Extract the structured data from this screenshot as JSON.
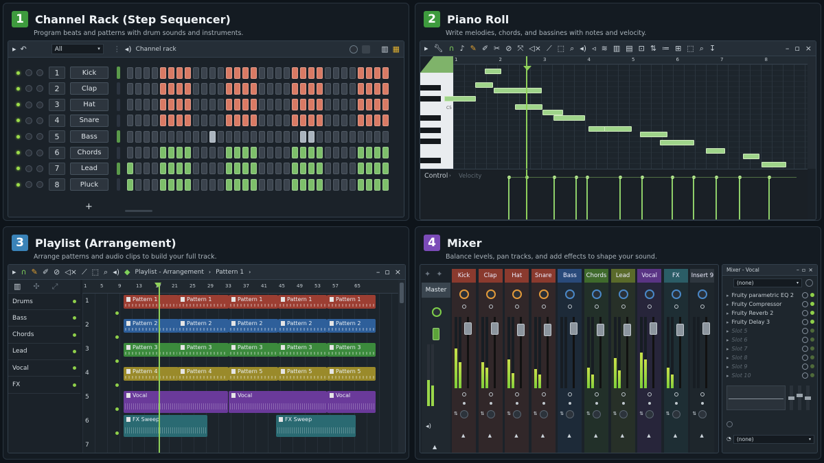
{
  "panel1": {
    "num": "1",
    "title": "Channel Rack (Step Sequencer)",
    "subtitle": "Program beats and patterns with drum sounds and instruments.",
    "color": "#3e9b3e",
    "toolbar": {
      "filter": "All",
      "window_title": "Channel rack"
    },
    "add_label": "+",
    "channels": [
      {
        "num": "1",
        "name": "Kick",
        "steps": [
          0,
          0,
          0,
          0,
          1,
          1,
          1,
          1,
          0,
          0,
          0,
          0,
          1,
          1,
          1,
          1,
          0,
          0,
          0,
          0,
          1,
          1,
          1,
          1,
          0,
          0,
          0,
          0,
          1,
          1,
          1,
          1
        ],
        "color": "#d97a64"
      },
      {
        "num": "2",
        "name": "Clap",
        "steps": [
          0,
          0,
          0,
          0,
          1,
          1,
          1,
          1,
          0,
          0,
          0,
          0,
          1,
          1,
          1,
          1,
          0,
          0,
          0,
          0,
          1,
          1,
          1,
          1,
          0,
          0,
          0,
          0,
          1,
          1,
          1,
          1
        ],
        "color": "#d97a64"
      },
      {
        "num": "3",
        "name": "Hat",
        "steps": [
          0,
          0,
          0,
          0,
          1,
          1,
          1,
          1,
          0,
          0,
          0,
          0,
          1,
          1,
          1,
          1,
          0,
          0,
          0,
          0,
          1,
          1,
          1,
          1,
          0,
          0,
          0,
          0,
          1,
          1,
          1,
          1
        ],
        "color": "#d97a64"
      },
      {
        "num": "4",
        "name": "Snare",
        "steps": [
          0,
          0,
          0,
          0,
          1,
          1,
          1,
          1,
          0,
          0,
          0,
          0,
          1,
          1,
          1,
          1,
          0,
          0,
          0,
          0,
          1,
          1,
          1,
          1,
          0,
          0,
          0,
          0,
          1,
          1,
          1,
          1
        ],
        "color": "#d97a64"
      },
      {
        "num": "5",
        "name": "Bass",
        "steps": [
          0,
          0,
          0,
          0,
          0,
          0,
          0,
          0,
          0,
          0,
          1,
          0,
          0,
          0,
          0,
          0,
          0,
          0,
          0,
          0,
          0,
          1,
          1,
          0,
          0,
          0,
          0,
          0,
          0,
          0,
          0,
          0
        ],
        "color": "#aab4be"
      },
      {
        "num": "6",
        "name": "Chords",
        "steps": [
          0,
          0,
          0,
          0,
          1,
          1,
          1,
          1,
          0,
          0,
          0,
          0,
          1,
          1,
          1,
          1,
          0,
          0,
          0,
          0,
          1,
          1,
          1,
          1,
          0,
          0,
          0,
          0,
          1,
          1,
          1,
          1
        ],
        "color": "#7dbf6a"
      },
      {
        "num": "7",
        "name": "Lead",
        "steps": [
          1,
          0,
          0,
          0,
          1,
          1,
          1,
          1,
          0,
          0,
          0,
          0,
          1,
          1,
          1,
          1,
          0,
          0,
          0,
          0,
          1,
          1,
          1,
          1,
          0,
          0,
          0,
          0,
          1,
          1,
          1,
          1
        ],
        "color": "#7dbf6a"
      },
      {
        "num": "8",
        "name": "Pluck",
        "steps": [
          1,
          0,
          0,
          0,
          1,
          1,
          1,
          1,
          0,
          0,
          0,
          0,
          1,
          1,
          1,
          1,
          0,
          0,
          0,
          0,
          1,
          1,
          1,
          1,
          0,
          0,
          0,
          0,
          1,
          1,
          1,
          1
        ],
        "color": "#7dbf6a"
      }
    ]
  },
  "panel2": {
    "num": "2",
    "title": "Piano Roll",
    "subtitle": "Write melodies, chords, and bassines with notes and velocity.",
    "color": "#3e9b3e",
    "ruler": [
      "1",
      "2",
      "3",
      "4",
      "5",
      "6",
      "7",
      "8"
    ],
    "key_label": "C5",
    "control_label": "Control",
    "velocity_label": "Velocity"
  },
  "panel3": {
    "num": "3",
    "title": "Playlist (Arrangement)",
    "subtitle": "Arrange patterns and audio clips to build your full track.",
    "color": "#3a83b8",
    "toolbar": {
      "window_title": "Playlist - Arrangement",
      "pattern": "Pattern 1"
    },
    "ruler": [
      "1",
      "5",
      "9",
      "13",
      "17",
      "21",
      "25",
      "29",
      "33",
      "37",
      "41",
      "45",
      "49",
      "53",
      "57",
      "65"
    ],
    "tracks": [
      "Drums",
      "Bass",
      "Chords",
      "Lead",
      "Vocal",
      "FX"
    ],
    "rows": [
      "1",
      "2",
      "3",
      "4",
      "5",
      "6",
      "7"
    ],
    "clips": {
      "r1": [
        "Pattern 1",
        "Pattern 1",
        "Pattern 1",
        "Pattern 1",
        "Pattern 1"
      ],
      "r2": [
        "Pattern 2",
        "Pattern 2",
        "Pattern 2",
        "Pattern 2",
        "Pattern 2"
      ],
      "r3": [
        "Pattern 3",
        "Pattern 3",
        "Pattern 3",
        "Pattern 3",
        "Pattern 3"
      ],
      "r4": [
        "Pattern 4",
        "Pattern 4",
        "Pattern 5",
        "Pattern 5",
        "Pattern 5"
      ],
      "r5": [
        "Vocal",
        "Vocal",
        "Vocal"
      ],
      "r6": [
        "FX Sweep",
        "FX Sweep"
      ]
    }
  },
  "panel4": {
    "num": "4",
    "title": "Mixer",
    "subtitle": "Balance levels, pan tracks, and add effects to shape your sound.",
    "color": "#7b4bb8",
    "master_label": "Master",
    "strips": [
      {
        "name": "Kick",
        "color": "#8a3a2e"
      },
      {
        "name": "Clap",
        "color": "#8a3a2e"
      },
      {
        "name": "Hat",
        "color": "#8a3a2e"
      },
      {
        "name": "Snare",
        "color": "#8a3a2e"
      },
      {
        "name": "Bass",
        "color": "#294a7a"
      },
      {
        "name": "Chords",
        "color": "#3f6a2c"
      },
      {
        "name": "Lead",
        "color": "#5a6a2a"
      },
      {
        "name": "Vocal",
        "color": "#5a3484"
      },
      {
        "name": "FX",
        "color": "#2b5d66"
      },
      {
        "name": "Insert 9",
        "color": "#2e363e"
      }
    ],
    "fx_window": {
      "title": "Mixer - Vocal",
      "input": "(none)",
      "output": "(none)",
      "slots": [
        "Fruity parametric EQ 2",
        "Fruity Compressor",
        "Fruity Reverb 2",
        "Fruity Delay 3",
        "Slot 5",
        "Slot 6",
        "Slot 7",
        "Slot 8",
        "Slot 9",
        "Slot 10"
      ]
    }
  }
}
